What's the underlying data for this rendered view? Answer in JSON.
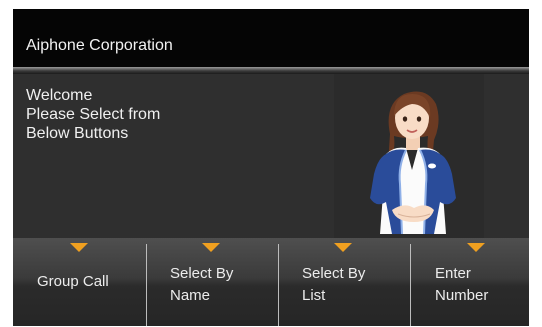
{
  "header": {
    "title": "Aiphone Corporation"
  },
  "welcome": {
    "line1": "Welcome",
    "line2": "Please Select from",
    "line3": "Below Buttons"
  },
  "softkeys": [
    {
      "line1": "Group Call",
      "line2": ""
    },
    {
      "line1": "Select By",
      "line2": "Name"
    },
    {
      "line1": "Select By",
      "line2": "List"
    },
    {
      "line1": "Enter",
      "line2": "Number"
    }
  ],
  "colors": {
    "arrow": "#f0a020",
    "screen_background": "#000000",
    "content_background": "#2f2f2f",
    "text": "#f0f0f0"
  },
  "icons": {
    "attendant": "receptionist-illustration",
    "softkey_indicator": "down-arrow-icon"
  }
}
